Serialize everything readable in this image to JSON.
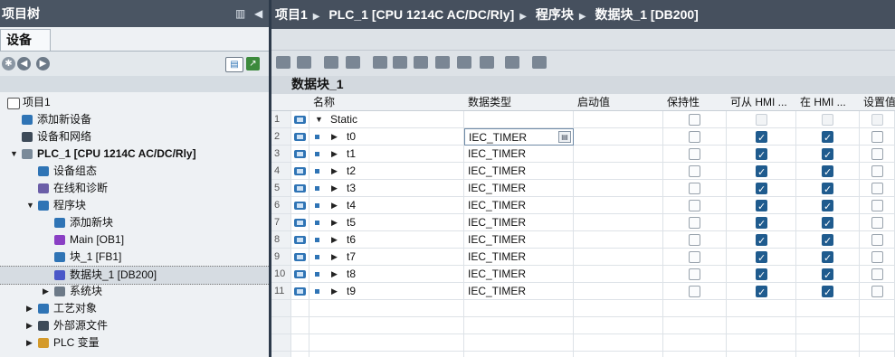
{
  "left_panel": {
    "title": "项目树",
    "device_tab": "设备",
    "tree": [
      {
        "label": "项目1"
      },
      {
        "label": "添加新设备"
      },
      {
        "label": "设备和网络"
      },
      {
        "label": "PLC_1 [CPU 1214C AC/DC/Rly]"
      },
      {
        "label": "设备组态"
      },
      {
        "label": "在线和诊断"
      },
      {
        "label": "程序块"
      },
      {
        "label": "添加新块"
      },
      {
        "label": "Main [OB1]"
      },
      {
        "label": "块_1 [FB1]"
      },
      {
        "label": "数据块_1 [DB200]"
      },
      {
        "label": "系统块"
      },
      {
        "label": "工艺对象"
      },
      {
        "label": "外部源文件"
      },
      {
        "label": "PLC 变量"
      }
    ]
  },
  "breadcrumb": [
    "项目1",
    "PLC_1 [CPU 1214C AC/DC/Rly]",
    "程序块",
    "数据块_1 [DB200]"
  ],
  "block_title": "数据块_1",
  "table": {
    "columns": [
      "名称",
      "数据类型",
      "启动值",
      "保持性",
      "可从 HMI ...",
      "在 HMI ...",
      "设置值"
    ],
    "rows": [
      {
        "num": "1",
        "name": "Static",
        "dtype": "",
        "retain": false,
        "hmi_access": false,
        "hmi_visible": false
      },
      {
        "num": "2",
        "name": "t0",
        "dtype": "IEC_TIMER",
        "retain": false,
        "hmi_access": true,
        "hmi_visible": true
      },
      {
        "num": "3",
        "name": "t1",
        "dtype": "IEC_TIMER",
        "retain": false,
        "hmi_access": true,
        "hmi_visible": true
      },
      {
        "num": "4",
        "name": "t2",
        "dtype": "IEC_TIMER",
        "retain": false,
        "hmi_access": true,
        "hmi_visible": true
      },
      {
        "num": "5",
        "name": "t3",
        "dtype": "IEC_TIMER",
        "retain": false,
        "hmi_access": true,
        "hmi_visible": true
      },
      {
        "num": "6",
        "name": "t4",
        "dtype": "IEC_TIMER",
        "retain": false,
        "hmi_access": true,
        "hmi_visible": true
      },
      {
        "num": "7",
        "name": "t5",
        "dtype": "IEC_TIMER",
        "retain": false,
        "hmi_access": true,
        "hmi_visible": true
      },
      {
        "num": "8",
        "name": "t6",
        "dtype": "IEC_TIMER",
        "retain": false,
        "hmi_access": true,
        "hmi_visible": true
      },
      {
        "num": "9",
        "name": "t7",
        "dtype": "IEC_TIMER",
        "retain": false,
        "hmi_access": true,
        "hmi_visible": true
      },
      {
        "num": "10",
        "name": "t8",
        "dtype": "IEC_TIMER",
        "retain": false,
        "hmi_access": true,
        "hmi_visible": true
      },
      {
        "num": "11",
        "name": "t9",
        "dtype": "IEC_TIMER",
        "retain": false,
        "hmi_access": true,
        "hmi_visible": true
      }
    ]
  },
  "colors": {
    "title_bar": "#4a5563",
    "accent": "#2f74b5",
    "checked": "#1f5b8e"
  }
}
